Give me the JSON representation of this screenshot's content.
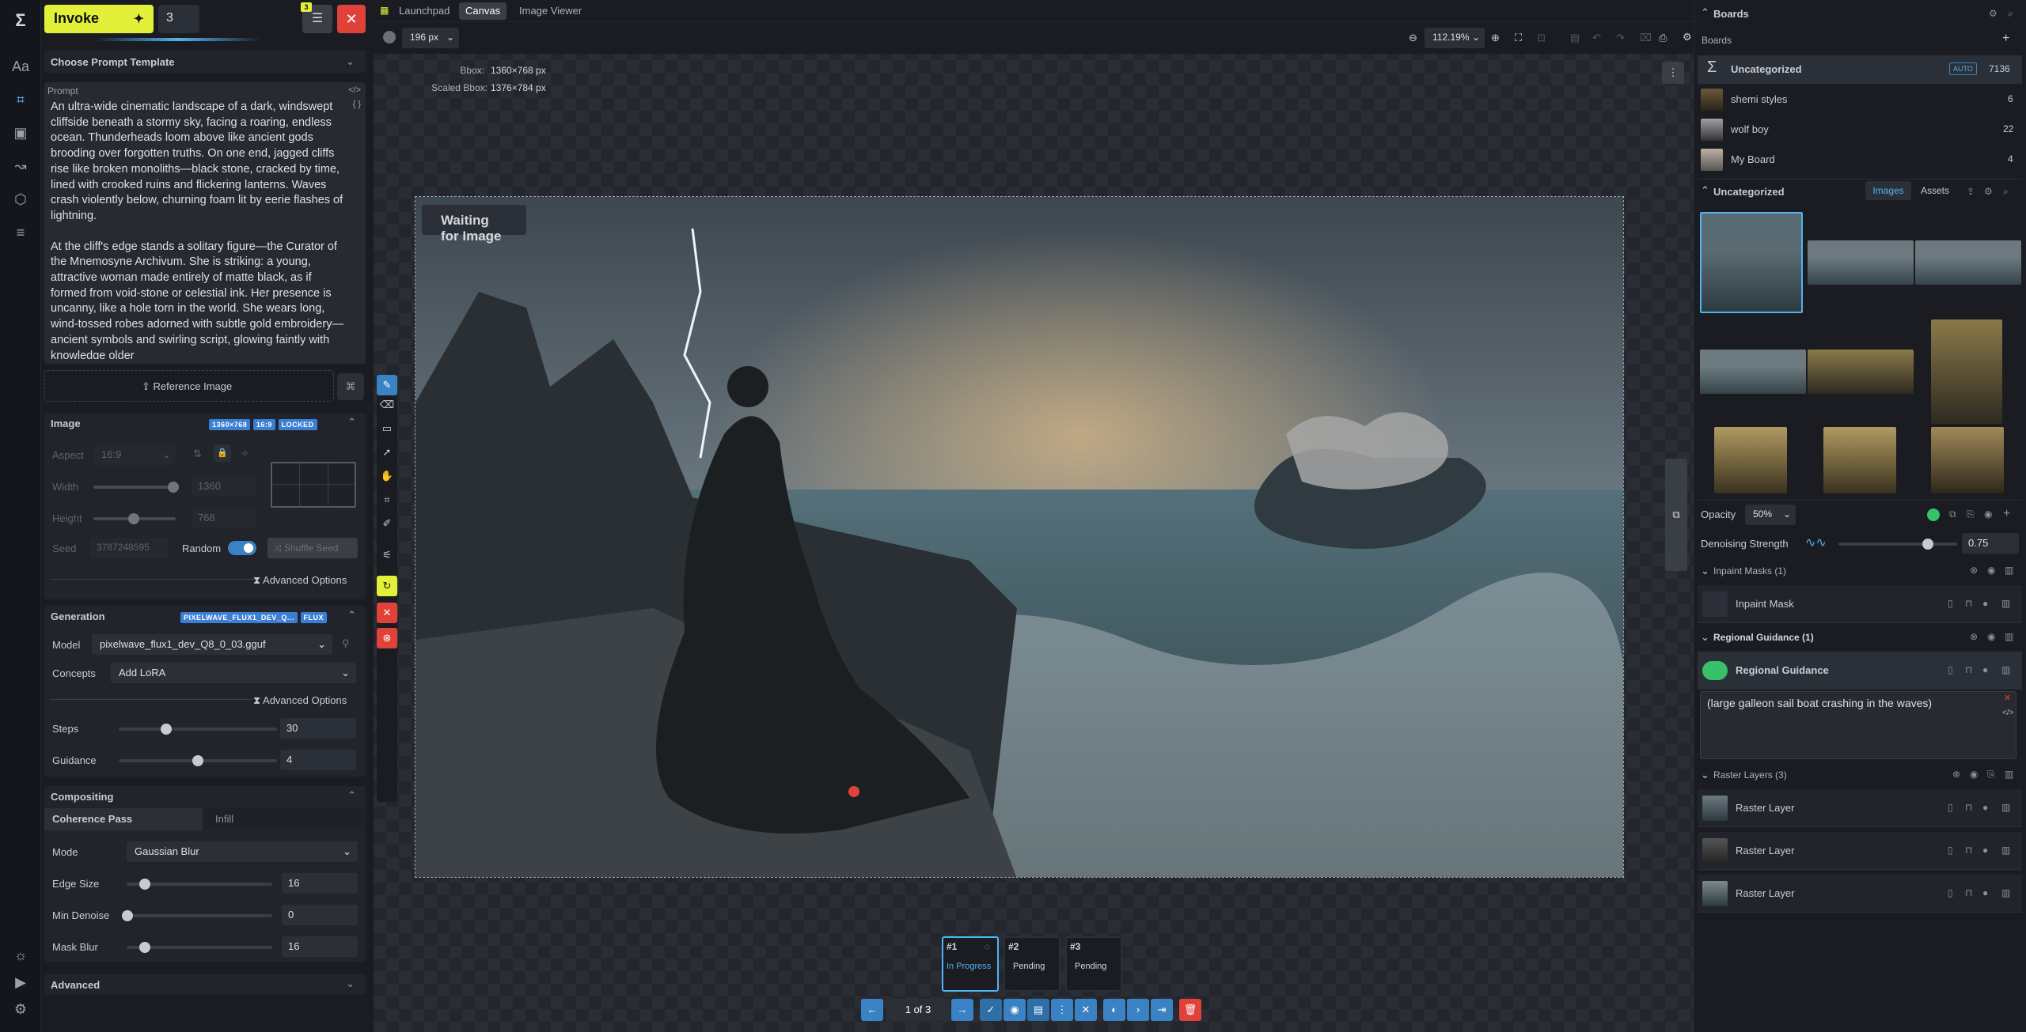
{
  "header": {
    "invoke_label": "Invoke",
    "queue_count": "3",
    "queue_badge": "3"
  },
  "left": {
    "prompt_template": "Choose Prompt Template",
    "prompt_label": "Prompt",
    "prompt_p1": "An ultra-wide cinematic landscape of a dark, windswept cliffside beneath a stormy sky, facing a roaring, endless ocean. Thunderheads loom above like ancient gods brooding over forgotten truths. On one end, jagged cliffs rise like broken monoliths—black stone, cracked by time, lined with crooked ruins and flickering lanterns. Waves crash violently below, churning foam lit by eerie flashes of lightning.",
    "prompt_p2": "At the cliff's edge stands a solitary figure—the Curator of the Mnemosyne Archivum. She is striking: a young, attractive woman made entirely of matte black, as if formed from void-stone or celestial ink. Her presence is uncanny, like a hole torn in the world. She wears long, wind-tossed robes adorned with subtle gold embroidery—ancient symbols and swirling script, glowing faintly with knowledge older",
    "reference_image": "Reference Image",
    "image_title": "Image",
    "image_badges": [
      "1360×768",
      "16:9",
      "LOCKED"
    ],
    "aspect_label": "Aspect",
    "aspect_value": "16:9",
    "width_label": "Width",
    "width_value": "1360",
    "height_label": "Height",
    "height_value": "768",
    "seed_label": "Seed",
    "seed_value": "3787248595",
    "random_label": "Random",
    "shuffle_seed": "Shuffle Seed",
    "advanced_options": "Advanced Options",
    "generation_title": "Generation",
    "generation_badges": [
      "PIXELWAVE_FLUX1_DEV_Q...",
      "FLUX"
    ],
    "model_label": "Model",
    "model_value": "pixelwave_flux1_dev_Q8_0_03.gguf",
    "concepts_label": "Concepts",
    "concepts_value": "Add LoRA",
    "advanced_options2": "Advanced Options",
    "steps_label": "Steps",
    "steps_value": "30",
    "steps_level": 0.3,
    "guidance_label": "Guidance",
    "guidance_value": "4",
    "guidance_level": 0.5,
    "compositing_title": "Compositing",
    "coherence_tab": "Coherence Pass",
    "infill_tab": "Infill",
    "mode_label": "Mode",
    "mode_value": "Gaussian Blur",
    "edge_label": "Edge Size",
    "edge_value": "16",
    "mindenoise_label": "Min Denoise",
    "mindenoise_value": "0",
    "maskblur_label": "Mask Blur",
    "maskblur_value": "16",
    "advanced_title": "Advanced"
  },
  "tabs": [
    "Launchpad",
    "Canvas",
    "Image Viewer"
  ],
  "toolbar": {
    "brush_size": "196 px",
    "zoom": "112.19%"
  },
  "canvas": {
    "bbox_label": "Bbox:",
    "bbox_value": "1360×768 px",
    "scaled_label": "Scaled Bbox:",
    "scaled_value": "1376×784 px",
    "waiting": "Waiting for Image"
  },
  "queue": {
    "items": [
      {
        "id": "#1",
        "status": "In Progress"
      },
      {
        "id": "#2",
        "status": "Pending"
      },
      {
        "id": "#3",
        "status": "Pending"
      }
    ],
    "pager": "1 of 3"
  },
  "right": {
    "boards_title": "Boards",
    "boards_sub": "Boards",
    "boards": [
      {
        "name": "Uncategorized",
        "tag": "AUTO",
        "count": "7136"
      },
      {
        "name": "shemi styles",
        "count": "6"
      },
      {
        "name": "wolf boy",
        "count": "22"
      },
      {
        "name": "My Board",
        "count": "4"
      }
    ],
    "gallery_title": "Uncategorized",
    "images_tab": "Images",
    "assets_tab": "Assets",
    "opacity_label": "Opacity",
    "opacity_value": "50%",
    "denoise_label": "Denoising Strength",
    "denoise_value": "0.75",
    "denoise_level": 0.75,
    "inpaint_group": "Inpaint Masks (1)",
    "inpaint_item": "Inpaint Mask",
    "regional_group": "Regional Guidance (1)",
    "regional_item": "Regional Guidance",
    "regional_prompt": "(large galleon sail boat crashing in the waves)",
    "raster_group": "Raster Layers (3)",
    "raster_items": [
      "Raster Layer",
      "Raster Layer",
      "Raster Layer"
    ]
  }
}
